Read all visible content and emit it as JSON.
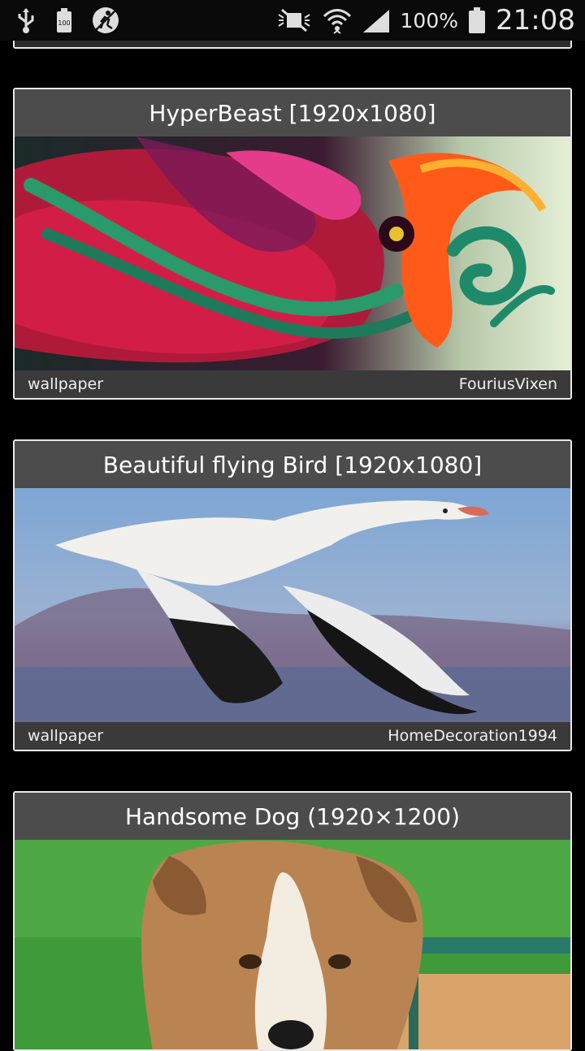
{
  "status_bar": {
    "battery_percent": "100%",
    "time": "21:08",
    "icons": [
      "usb-icon",
      "battery-full-icon",
      "no-run-icon",
      "silent-mode-icon",
      "wifi-icon",
      "signal-icon",
      "battery-icon"
    ]
  },
  "cards": [
    {
      "title": "HyperBeast [1920x1080]",
      "category": "wallpaper",
      "author": "FouriusVixen"
    },
    {
      "title": "Beautiful flying Bird [1920x1080]",
      "category": "wallpaper",
      "author": "HomeDecoration1994"
    },
    {
      "title": "Handsome Dog (1920×1200)"
    }
  ]
}
